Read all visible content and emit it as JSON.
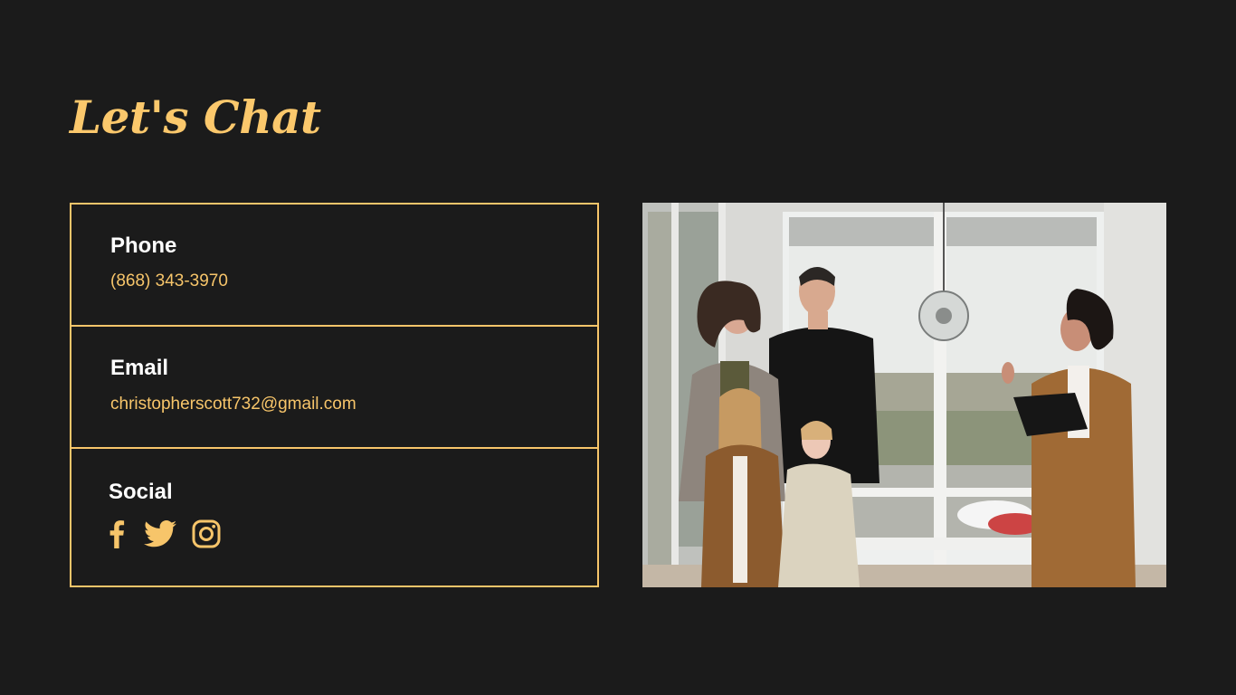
{
  "page": {
    "title": "Let's Chat"
  },
  "contact": {
    "phone": {
      "label": "Phone",
      "value": "(868) 343-3970"
    },
    "email": {
      "label": "Email",
      "value": "christopherscott732@gmail.com"
    },
    "social": {
      "label": "Social",
      "icons": [
        "facebook-icon",
        "twitter-icon",
        "instagram-icon"
      ]
    }
  },
  "photo": {
    "subject": "real-estate-agent-with-family-photo"
  },
  "colors": {
    "background": "#1b1b1b",
    "accent": "#f7c56a",
    "title": "#fbc86c",
    "label": "#ffffff"
  }
}
